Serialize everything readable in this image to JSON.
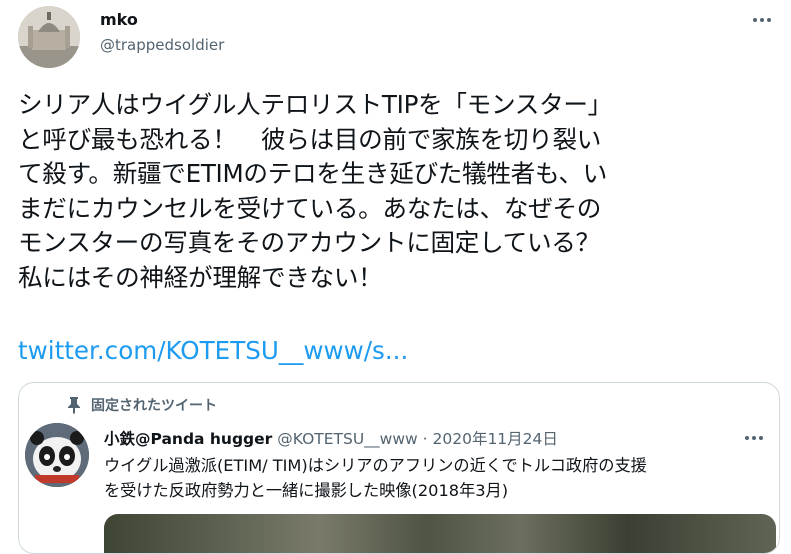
{
  "author": {
    "name": "mko",
    "handle": "@trappedsoldier"
  },
  "tweet": {
    "lines": [
      "シリア人はウイグル人テロリストTIPを「モンスター」",
      "と呼び最も恐れる！　彼らは目の前で家族を切り裂い",
      "て殺す。新疆でETIMのテロを生き延びた犠牲者も、い",
      "まだにカウンセルを受けている。あなたは、なぜその",
      "モンスターの写真をそのアカウントに固定している？",
      "私にはその神経が理解できない！"
    ],
    "link": "twitter.com/KOTETSU__www/s..."
  },
  "quoted": {
    "pinned_label": "固定されたツイート",
    "name": "小鉄@Panda hugger",
    "handle": "@KOTETSU__www",
    "separator": " · ",
    "date": "2020年11月24日",
    "lines": [
      "ウイグル過激派(ETIM/ TIM)はシリアのアフリンの近くでトルコ政府の支援",
      "を受けた反政府勢力と一緒に撮影した映像(2018年3月)"
    ]
  },
  "colors": {
    "link": "#1d9bf0",
    "secondary_text": "#536471",
    "border": "#cfd9de"
  },
  "icons": [
    "more-options-icon",
    "pin-icon"
  ]
}
